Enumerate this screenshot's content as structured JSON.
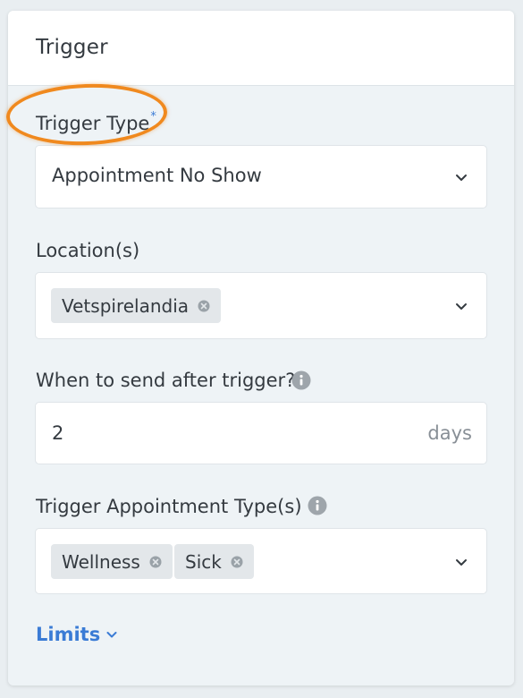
{
  "panel": {
    "title": "Trigger"
  },
  "trigger_type": {
    "label": "Trigger Type",
    "required_mark": "*",
    "value": "Appointment No Show"
  },
  "locations": {
    "label": "Location(s)",
    "chips": [
      "Vetspirelandia"
    ]
  },
  "send_after": {
    "label": "When to send after trigger?",
    "value": "2",
    "suffix": "days"
  },
  "appointment_types": {
    "label": "Trigger Appointment Type(s)",
    "chips": [
      "Wellness",
      "Sick"
    ]
  },
  "limits": {
    "label": "Limits"
  },
  "colors": {
    "accent": "#3a7bd5",
    "annotation": "#f0891e"
  },
  "icons": {
    "info": "info-circle-icon",
    "dropdown": "chevron-down-icon",
    "chip_remove": "close-circle-icon"
  }
}
